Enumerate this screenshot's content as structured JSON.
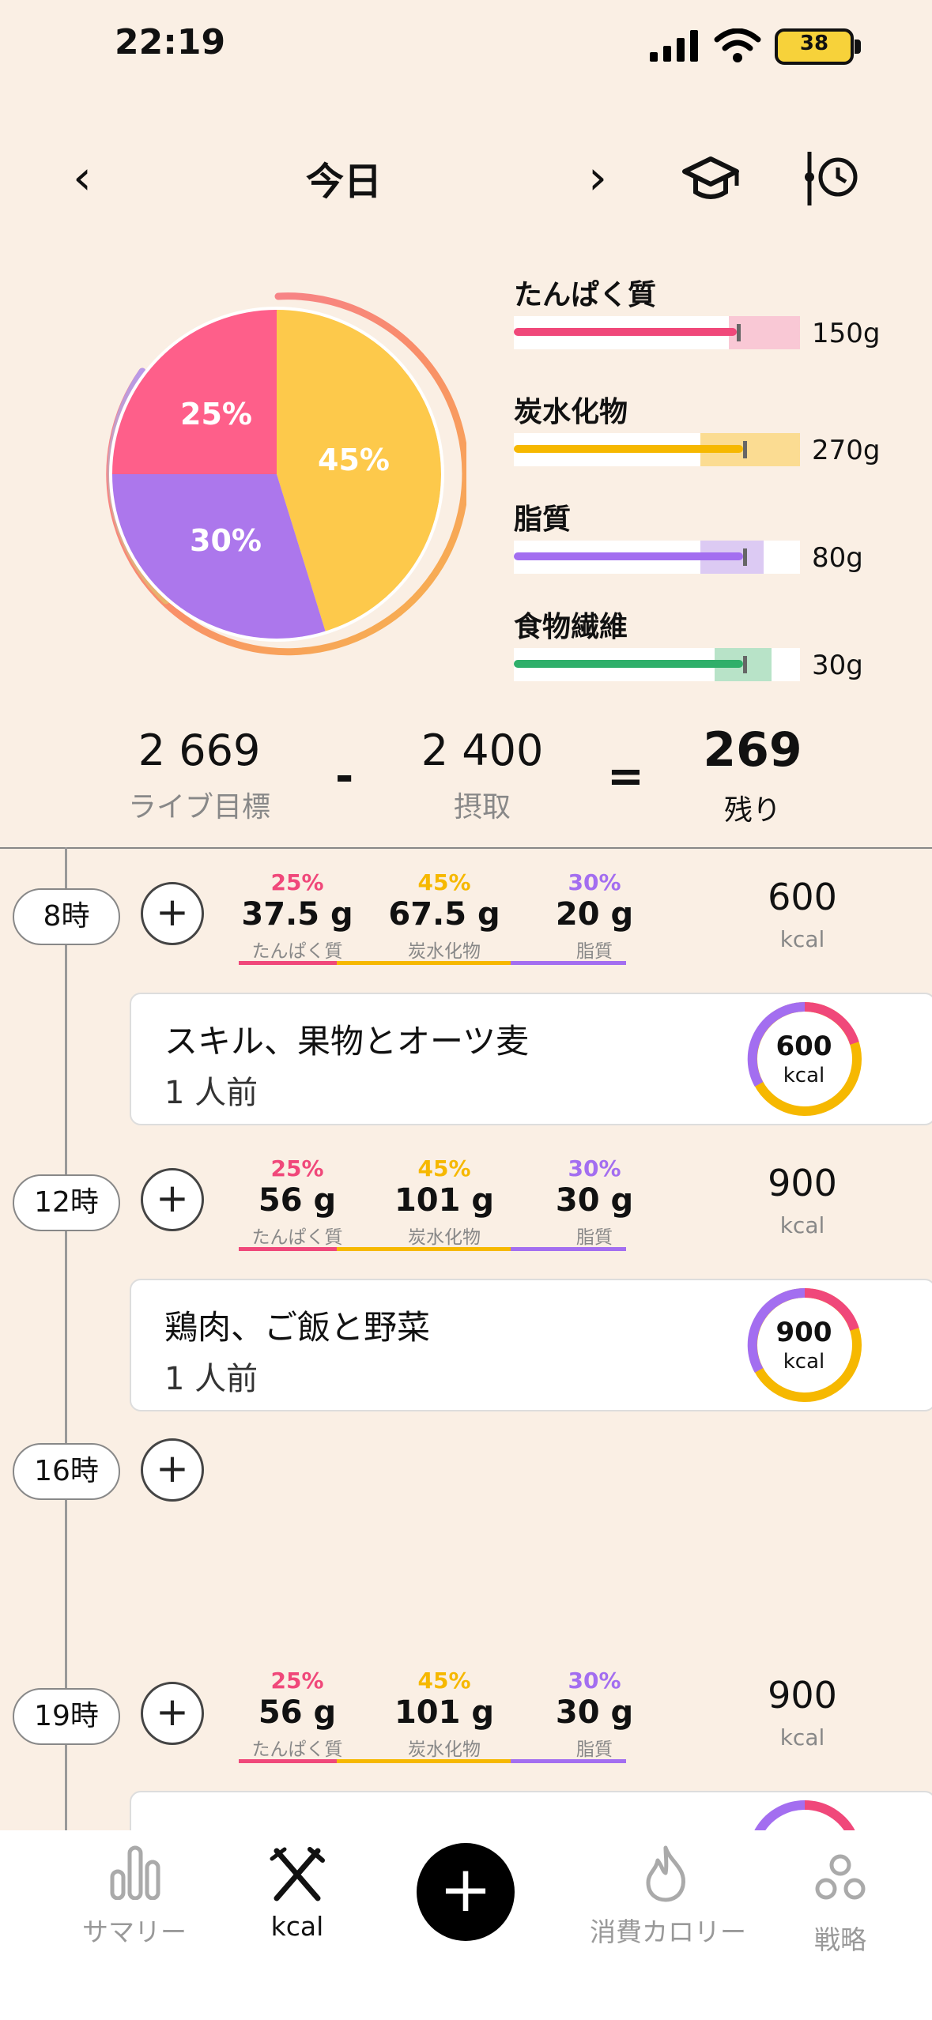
{
  "status": {
    "time": "22:19",
    "battery": "38"
  },
  "header": {
    "title": "今日"
  },
  "pie": {
    "protein_pct": "25%",
    "carbs_pct": "45%",
    "fat_pct": "30%"
  },
  "macros": [
    {
      "label": "たんぱく質",
      "value": "150g",
      "color": "#f0487a",
      "fill": 0.78
    },
    {
      "label": "炭水化物",
      "value": "270g",
      "color": "#f6b800",
      "fill": 0.8
    },
    {
      "label": "脂質",
      "value": "80g",
      "color": "#a36ef0",
      "fill": 0.79
    },
    {
      "label": "食物繊維",
      "value": "30g",
      "color": "#2faf6a",
      "fill": 0.8
    }
  ],
  "totals": {
    "goal_value": "2 669",
    "goal_label": "ライブ目標",
    "minus": "-",
    "intake_value": "2 400",
    "intake_label": "摂取",
    "equals": "=",
    "remaining_value": "269",
    "remaining_label": "残り"
  },
  "meals": [
    {
      "hour": "8時",
      "protein_pct": "25%",
      "carbs_pct": "45%",
      "fat_pct": "30%",
      "protein_g": "37.5 g",
      "carbs_g": "67.5 g",
      "fat_g": "20 g",
      "protein_lbl": "たんぱく質",
      "carbs_lbl": "炭水化物",
      "fat_lbl": "脂質",
      "kcal": "600",
      "kcal_unit": "kcal",
      "item": {
        "title": "スキル、果物とオーツ麦",
        "sub": "1 人前",
        "kcal": "600",
        "unit": "kcal"
      }
    },
    {
      "hour": "12時",
      "protein_pct": "25%",
      "carbs_pct": "45%",
      "fat_pct": "30%",
      "protein_g": "56 g",
      "carbs_g": "101 g",
      "fat_g": "30 g",
      "protein_lbl": "たんぱく質",
      "carbs_lbl": "炭水化物",
      "fat_lbl": "脂質",
      "kcal": "900",
      "kcal_unit": "kcal",
      "item": {
        "title": "鶏肉、ご飯と野菜",
        "sub": "1 人前",
        "kcal": "900",
        "unit": "kcal"
      }
    },
    {
      "hour": "16時"
    },
    {
      "hour": "19時",
      "protein_pct": "25%",
      "carbs_pct": "45%",
      "fat_pct": "30%",
      "protein_g": "56 g",
      "carbs_g": "101 g",
      "fat_g": "30 g",
      "protein_lbl": "たんぱく質",
      "carbs_lbl": "炭水化物",
      "fat_lbl": "脂質",
      "kcal": "900",
      "kcal_unit": "kcal"
    }
  ],
  "nav": {
    "summary": "サマリー",
    "kcal": "kcal",
    "burned": "消費カロリー",
    "strategy": "戦略"
  },
  "icons": [
    "signal-icon",
    "wifi-icon",
    "battery-icon",
    "chevron-left-icon",
    "chevron-right-icon",
    "graduation-cap-icon",
    "timeline-clock-icon",
    "plus-icon",
    "bar-chart-icon",
    "fork-knife-icon",
    "flame-icon",
    "circles-icon"
  ]
}
